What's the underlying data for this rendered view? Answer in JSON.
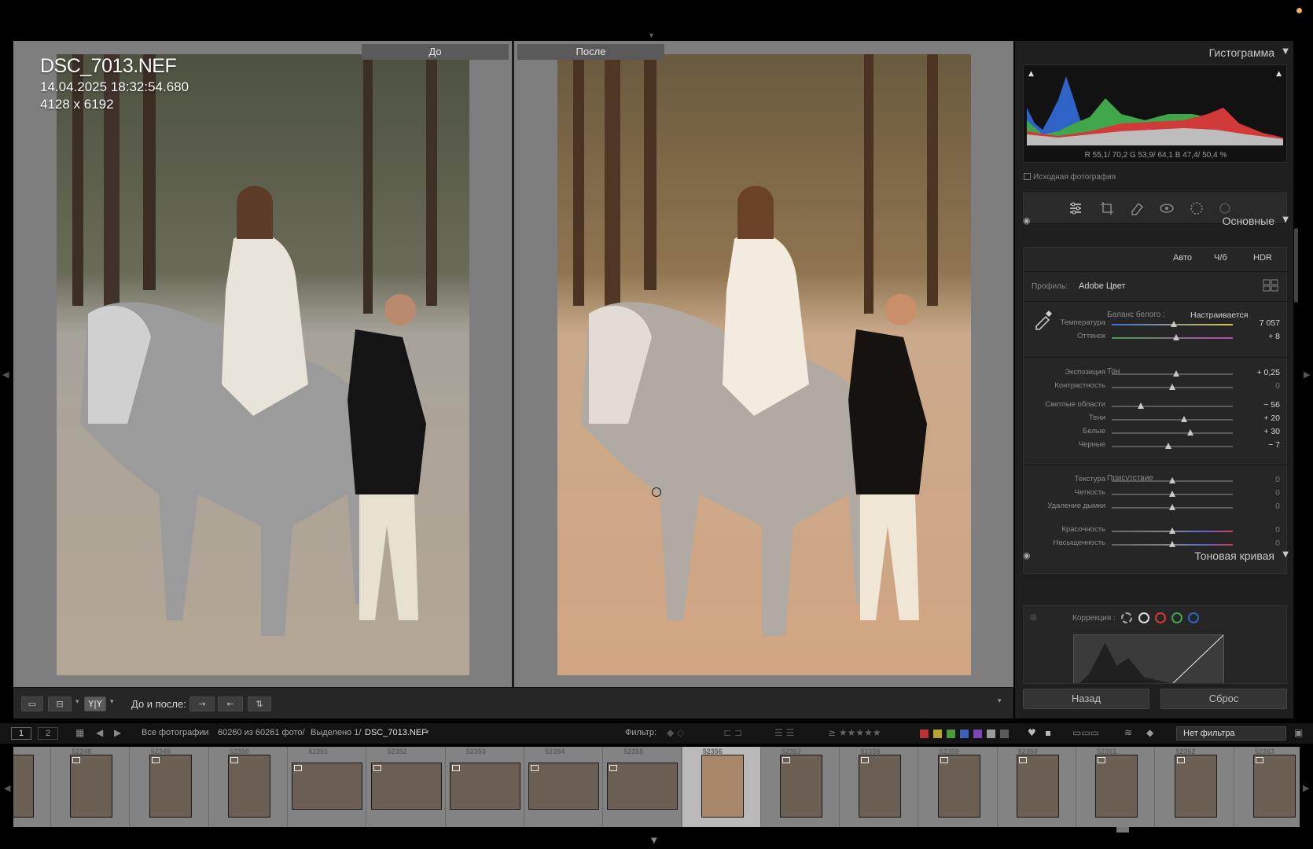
{
  "photo": {
    "filename": "DSC_7013.NEF",
    "datetime": "14.04.2025 18:32:54.680",
    "dimensions": "4128 x 6192"
  },
  "compare": {
    "before_label": "До",
    "after_label": "После"
  },
  "toolbar": {
    "before_after_label": "До и после:",
    "view_single": "single-view-icon",
    "view_compare": "compare-view-icon",
    "view_yy": "Y|Y"
  },
  "histogram": {
    "title": "Гистограмма",
    "readout": "R 55,1/ 70,2 G 53,9/ 64,1 B 47,4/ 50,4 %",
    "original_photo": "Исходная фотография",
    "colors": {
      "red": "#d23a3a",
      "green": "#3fa64a",
      "blue": "#2f63c8",
      "gray": "#bdbdbd"
    }
  },
  "basic": {
    "title": "Основные",
    "modes": [
      "Авто",
      "Ч/б",
      "HDR"
    ],
    "profile_label": "Профиль:",
    "profile_value": "Adobe Цвет",
    "wb_label": "Баланс белого :",
    "wb_value": "Настраивается",
    "tone_title": "Тон",
    "presence_title": "Присутствие",
    "sliders": [
      {
        "label": "Температура",
        "value": "7 057",
        "pos": 0.51,
        "kind": "temp"
      },
      {
        "label": "Оттенок",
        "value": "+ 8",
        "pos": 0.53,
        "kind": "tint"
      },
      {
        "label": "Экспозиция",
        "value": "+ 0,25",
        "pos": 0.53,
        "kind": "plain"
      },
      {
        "label": "Контрастность",
        "value": "0",
        "pos": 0.5,
        "kind": "plain"
      },
      {
        "label": "Светлые области",
        "value": "− 56",
        "pos": 0.24,
        "kind": "plain"
      },
      {
        "label": "Тени",
        "value": "+ 20",
        "pos": 0.6,
        "kind": "plain"
      },
      {
        "label": "Белые",
        "value": "+ 30",
        "pos": 0.65,
        "kind": "plain"
      },
      {
        "label": "Черные",
        "value": "− 7",
        "pos": 0.47,
        "kind": "plain"
      },
      {
        "label": "Текстура",
        "value": "0",
        "pos": 0.5,
        "kind": "plain"
      },
      {
        "label": "Четкость",
        "value": "0",
        "pos": 0.5,
        "kind": "plain"
      },
      {
        "label": "Удаление дымки",
        "value": "0",
        "pos": 0.5,
        "kind": "plain"
      },
      {
        "label": "Красочность",
        "value": "0",
        "pos": 0.5,
        "kind": "sat"
      },
      {
        "label": "Насыщенность",
        "value": "0",
        "pos": 0.5,
        "kind": "sat"
      }
    ]
  },
  "tone_curve": {
    "title": "Тоновая кривая",
    "correction_label": "Коррекция :"
  },
  "panel_buttons": {
    "back": "Назад",
    "reset": "Сброс"
  },
  "filmstrip_bar": {
    "page1": "1",
    "page2": "2",
    "source": "Все фотографии",
    "count": "60260 из 60261 фото/",
    "selected": "Выделено 1/",
    "current_file": "DSC_7013.NEF",
    "filter_label": "Фильтр:",
    "filter_value": "Нет фильтра",
    "label_colors": [
      "#b83232",
      "#b9a22e",
      "#4c9a3b",
      "#3f5fb7",
      "#7a45b5",
      "#9a9a9a",
      "#5a5a5a"
    ]
  },
  "filmstrip": {
    "numbers": [
      "",
      "52348",
      "52349",
      "52350",
      "52351",
      "52352",
      "52353",
      "52354",
      "52355",
      "52356",
      "52357",
      "52358",
      "52359",
      "52360",
      "52361",
      "52362",
      "52363"
    ],
    "selected_index": 9
  }
}
